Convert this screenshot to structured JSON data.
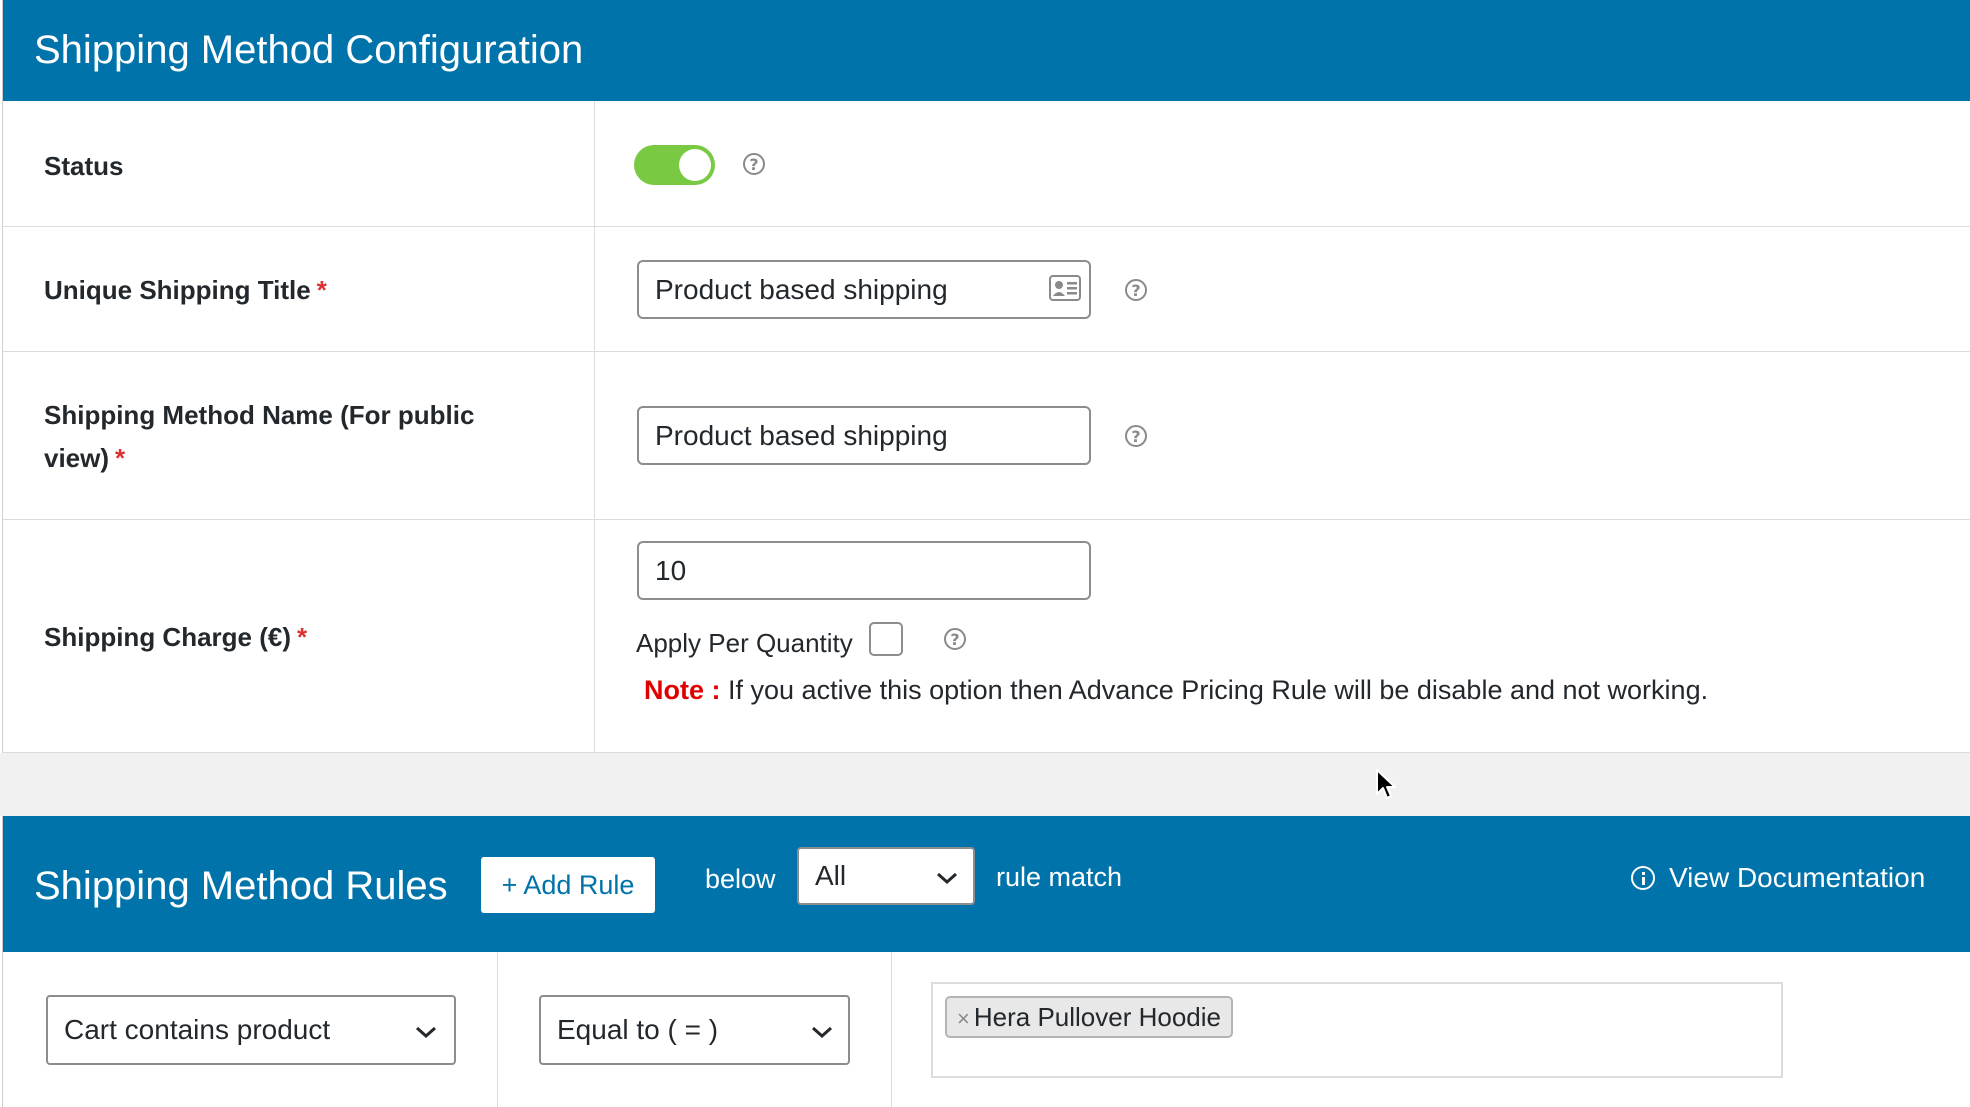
{
  "config": {
    "title": "Shipping Method Configuration",
    "status": {
      "label": "Status",
      "enabled": true
    },
    "unique_title": {
      "label": "Unique Shipping Title",
      "required_mark": "*",
      "value": "Product based shipping"
    },
    "public_name": {
      "label_line1": "Shipping Method Name (For public",
      "label_line2": "view)",
      "required_mark": "*",
      "value": "Product based shipping"
    },
    "charge": {
      "label": "Shipping Charge (€)",
      "required_mark": "*",
      "value": "10",
      "per_quantity_label": "Apply Per Quantity",
      "per_quantity_checked": false,
      "note_label": "Note :",
      "note_text": "If you active this option then Advance Pricing Rule will be disable and not working."
    },
    "help_glyph": "?"
  },
  "rules": {
    "title": "Shipping Method Rules",
    "add_rule": "+ Add Rule",
    "below_text": "below",
    "match_value": "All",
    "rule_match_text": "rule match",
    "doc_link": "View Documentation",
    "rule": {
      "condition": "Cart contains product",
      "operator": "Equal to ( = )",
      "products": [
        {
          "remove": "×",
          "name": "Hera Pullover Hoodie"
        }
      ]
    }
  },
  "colors": {
    "header_bg": "#0073aa",
    "toggle_on": "#7ac943",
    "required": "#dc3232"
  },
  "icons": [
    "help-icon",
    "contact-card-icon",
    "chevron-down-icon",
    "info-icon",
    "mouse-cursor-icon"
  ]
}
